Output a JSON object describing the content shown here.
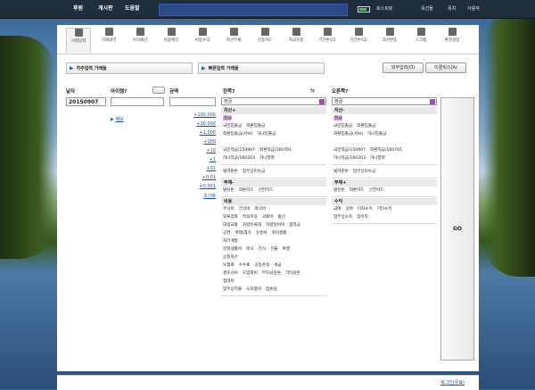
{
  "topnav": [
    "후원",
    "게시판",
    "도움말"
  ],
  "topmenu": [
    "호스트릿",
    "목선들",
    "목치",
    "사용자"
  ],
  "toolbar": [
    {
      "label": "거래입력",
      "icon": "pencil-icon"
    },
    {
      "label": "거래내역",
      "icon": "list-icon"
    },
    {
      "label": "수익예산",
      "icon": "money-icon"
    },
    {
      "label": "비용예산",
      "icon": "wallet-icon"
    },
    {
      "label": "비용수익",
      "icon": "transfer-icon"
    },
    {
      "label": "자산부채",
      "icon": "home-icon"
    },
    {
      "label": "신용카드",
      "icon": "card-icon"
    },
    {
      "label": "자금흐름",
      "icon": "flow-icon"
    },
    {
      "label": "기간손익1",
      "icon": "chart-icon"
    },
    {
      "label": "기간손익2",
      "icon": "chart-icon"
    },
    {
      "label": "자산변동",
      "icon": "mountain-icon"
    },
    {
      "label": "스크랩",
      "icon": "clip-icon"
    },
    {
      "label": "환경설정",
      "icon": "gear-icon"
    }
  ],
  "auto_label": "자주입력 거래들",
  "recent_label": "빠른입력 거래들",
  "buttons": {
    "extra": "외부입력(O)",
    "clip": "이클릭스(A)",
    "go": "GO"
  },
  "form": {
    "date_label": "날자",
    "date_value": "20150907",
    "item_label": "아이템?",
    "amount_label": "금액",
    "memo": "메모",
    "amounts": [
      "+100,000",
      "+10,000",
      "+1,000",
      "+100",
      "+10",
      "+1",
      "+01",
      "+0,01",
      "+0,001",
      "초기화"
    ]
  },
  "left": {
    "title": "왼쪽?",
    "select": "현금",
    "sections": [
      {
        "head": "자산+",
        "rows": [
          [
            "현금"
          ],
          [
            "국민입출금",
            "외환입출금"
          ],
          [
            "외환입출금(서브)",
            "하나입출금"
          ],
          [
            ""
          ],
          [
            "국민적금/150907",
            "외환적금/160701"
          ],
          [
            "하나적금/160203",
            "하나청약"
          ]
        ]
      },
      {
        "head": "",
        "rows": [
          [
            "빌려준돈",
            "업무상미수금"
          ]
        ]
      },
      {
        "head": "부채-",
        "rows": [
          [
            "빌린돈",
            "외환카드",
            "신한카드"
          ]
        ]
      },
      {
        "head": "비용",
        "rows": [
          [
            "주식비",
            "간식비",
            "외식비"
          ],
          [
            "외류잡화",
            "목욕미용",
            "의료비",
            "통신"
          ],
          [
            "대중교통",
            "차량유류대",
            "차량정비비",
            "범칙금"
          ],
          [
            "공연",
            "여행/휴가",
            "유흥비",
            "취미생활"
          ],
          [
            "자기계발"
          ],
          [
            "문화생활비",
            "외식",
            "간식",
            "선물",
            "여행"
          ],
          [
            "공동자산"
          ],
          [
            "보험료",
            "수수료",
            "공동손실",
            "세금"
          ],
          [
            "경조사비",
            "모임회비",
            "부모님용돈",
            "기타용돈"
          ],
          [
            "접대비"
          ],
          [
            "업무상지출",
            "소모품비",
            "잡손실"
          ]
        ]
      }
    ]
  },
  "right": {
    "title": "오른쪽?",
    "select": "현금",
    "sections": [
      {
        "head": "자산-",
        "rows": [
          [
            "현금"
          ],
          [
            "국민입출금",
            "외환입출금"
          ],
          [
            "외환입출금(서브)",
            "하나입출금"
          ],
          [
            ""
          ],
          [
            "국민적금/150907",
            "외환적금/160701"
          ],
          [
            "하나적금/160203",
            "하나청약"
          ]
        ]
      },
      {
        "head": "",
        "rows": [
          [
            "빌려준돈",
            "업무상미수금"
          ]
        ]
      },
      {
        "head": "부채+",
        "rows": [
          [
            "빌린돈",
            "외환카드",
            "신한카드"
          ]
        ]
      },
      {
        "head": "수익",
        "rows": [
          [
            "급여",
            "상여",
            "이자소득",
            "기타소득"
          ],
          [
            "업무상소득",
            "잡이익"
          ]
        ]
      }
    ]
  },
  "footer": "로그인(유료)"
}
